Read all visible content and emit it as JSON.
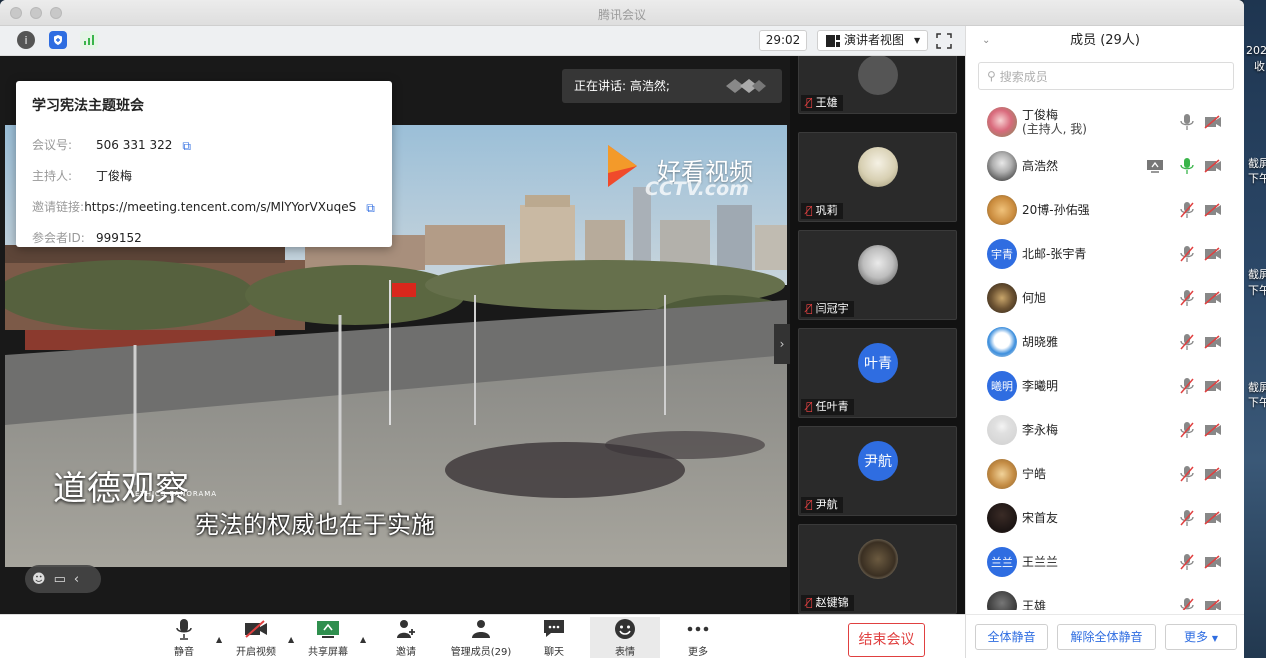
{
  "window": {
    "title": "腾讯会议"
  },
  "topbar": {
    "timer": "29:02",
    "view_label": "演讲者视图"
  },
  "info": {
    "title": "学习宪法主题班会",
    "rows": [
      {
        "label": "会议号:",
        "value": "506 331 322",
        "copy": true
      },
      {
        "label": "主持人:",
        "value": "丁俊梅",
        "copy": false
      },
      {
        "label": "邀请链接:",
        "value": "https://meeting.tencent.com/s/MlYYorVXuqeS",
        "copy": true
      },
      {
        "label": "参会者ID:",
        "value": "999152",
        "copy": false
      }
    ]
  },
  "speaking": {
    "text": "正在讲话: 高浩然;"
  },
  "video": {
    "watermark": "好看视频",
    "watermark_sub": "CCTV.com",
    "logo_text": "道德观察",
    "logo_text_en": "ETHICS PANORAMA",
    "subtitle": "宪法的权威也在于实施"
  },
  "thumbnails": [
    {
      "name": "王雄",
      "avatar": "partial-gray",
      "muted": true
    },
    {
      "name": "巩莉",
      "avatar": "photo-cat",
      "muted": true
    },
    {
      "name": "闫冠宇",
      "avatar": "photo-girl",
      "muted": true
    },
    {
      "name": "任叶青",
      "avatar_text": "叶青",
      "muted": true
    },
    {
      "name": "尹航",
      "avatar_text": "尹航",
      "muted": true
    },
    {
      "name": "赵键锦",
      "avatar": "photo-owl",
      "muted": true
    }
  ],
  "toolbar": {
    "mute": "静音",
    "video": "开启视频",
    "share": "共享屏幕",
    "invite": "邀请",
    "manage": "管理成员(29)",
    "chat": "聊天",
    "reaction": "表情",
    "more": "更多",
    "end": "结束会议"
  },
  "members": {
    "title": "成员 (29人)",
    "search_placeholder": "搜索成员",
    "list": [
      {
        "name": "丁俊梅",
        "sub": "(主持人, 我)",
        "avatar": "photo-flower",
        "mic": "off-gray",
        "cam": "off"
      },
      {
        "name": "高浩然",
        "avatar": "photo-person",
        "mic": "on-green",
        "cam": "off",
        "sharing": true
      },
      {
        "name": "20博-孙佑强",
        "avatar": "photo-dog",
        "mic": "muted",
        "cam": "off"
      },
      {
        "name": "北邮-张宇青",
        "avatar_text": "宇青",
        "mic": "muted",
        "cam": "off"
      },
      {
        "name": "何旭",
        "avatar": "photo-leopard",
        "mic": "muted",
        "cam": "off"
      },
      {
        "name": "胡晓雅",
        "avatar": "photo-doraemon",
        "mic": "muted",
        "cam": "off"
      },
      {
        "name": "李曦明",
        "avatar_text": "曦明",
        "mic": "muted",
        "cam": "off"
      },
      {
        "name": "李永梅",
        "avatar": "default-gray",
        "mic": "muted",
        "cam": "off"
      },
      {
        "name": "宁皓",
        "avatar": "photo-lion",
        "mic": "muted",
        "cam": "off"
      },
      {
        "name": "宋首友",
        "avatar": "photo-dark",
        "mic": "muted",
        "cam": "off"
      },
      {
        "name": "王兰兰",
        "avatar_text": "兰兰",
        "mic": "muted",
        "cam": "off"
      },
      {
        "name": "王雄",
        "avatar": "photo-partial",
        "mic": "muted",
        "cam": "off"
      }
    ],
    "footer": {
      "mute_all": "全体静音",
      "unmute_all": "解除全体静音",
      "more": "更多"
    }
  },
  "desktop": {
    "labels": [
      "202",
      "收",
      "截屏",
      "下午",
      "截屏",
      "下午",
      "截屏",
      "下午"
    ]
  },
  "colors": {
    "accent": "#2f6de1",
    "danger": "#e04040",
    "muted_mic": "#e04040",
    "active_mic": "#3ab54a"
  }
}
